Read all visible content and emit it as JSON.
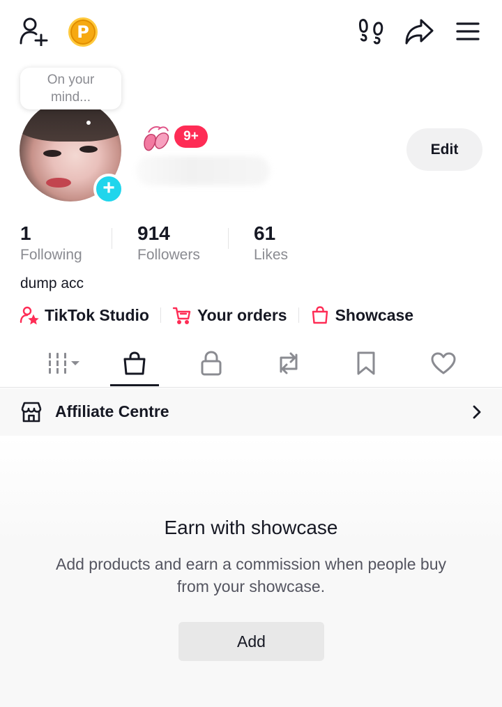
{
  "header": {
    "icons": [
      "add-friend-icon",
      "coin-icon",
      "footprints-icon",
      "share-icon",
      "menu-icon"
    ],
    "coin_letter": "P"
  },
  "profile": {
    "bubble_text": "On your mind...",
    "notification_badge": "9+",
    "edit_label": "Edit"
  },
  "stats": [
    {
      "value": "1",
      "label": "Following"
    },
    {
      "value": "914",
      "label": "Followers"
    },
    {
      "value": "61",
      "label": "Likes"
    }
  ],
  "bio": "dump acc",
  "links": [
    {
      "label": "TikTok Studio",
      "icon": "studio-icon"
    },
    {
      "label": "Your orders",
      "icon": "cart-icon"
    },
    {
      "label": "Showcase",
      "icon": "bag-icon"
    }
  ],
  "tabs": [
    "grid-icon",
    "shopping-bag-icon",
    "lock-icon",
    "repost-icon",
    "bookmark-icon",
    "heart-icon"
  ],
  "active_tab": "shopping-bag-icon",
  "affiliate": {
    "label": "Affiliate Centre"
  },
  "empty_state": {
    "title": "Earn with showcase",
    "description": "Add products and earn a commission when people buy from your showcase.",
    "button": "Add"
  },
  "colors": {
    "accent_red": "#fe2c55",
    "accent_cyan": "#20d5ec",
    "coin": "#f6a911"
  }
}
